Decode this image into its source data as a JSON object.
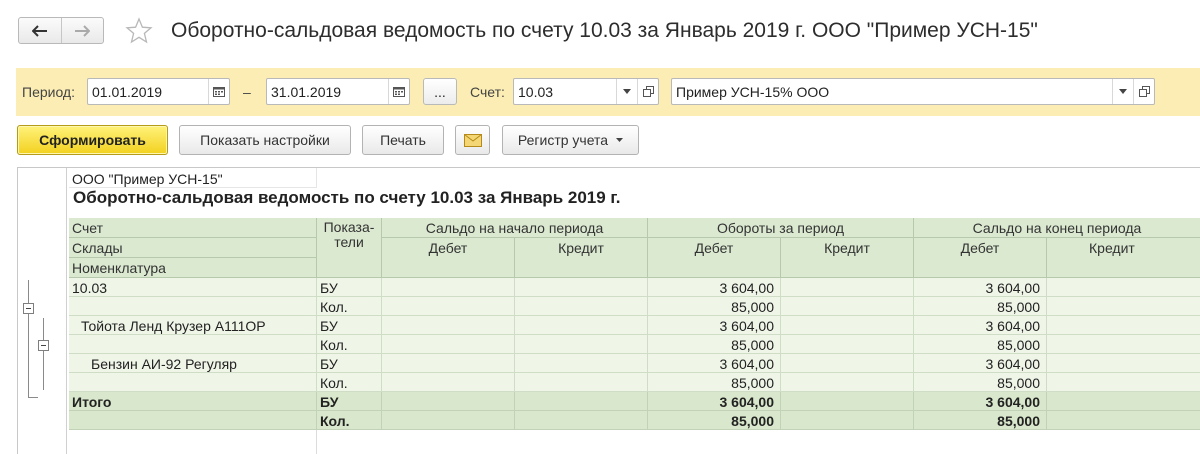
{
  "header": {
    "title": "Оборотно-сальдовая ведомость по счету 10.03 за Январь 2019 г. ООО \"Пример УСН-15\"",
    "back_icon": "arrow-left-icon",
    "forward_icon": "arrow-right-icon",
    "favorite_icon": "star-icon"
  },
  "filters": {
    "period_label": "Период:",
    "date_from": "01.01.2019",
    "dash": "–",
    "date_to": "31.01.2019",
    "more_label": "...",
    "account_label": "Счет:",
    "account_value": "10.03",
    "org_value": "Пример УСН-15% ООО"
  },
  "toolbar": {
    "generate": "Сформировать",
    "show_settings": "Показать настройки",
    "print": "Печать",
    "register": "Регистр учета"
  },
  "report": {
    "org": "ООО \"Пример УСН-15\"",
    "title": "Оборотно-сальдовая ведомость по счету 10.03 за Январь 2019 г.",
    "headers": {
      "account": "Счет",
      "warehouses": "Склады",
      "nomenclature": "Номенклатура",
      "indicators_1": "Показа-",
      "indicators_2": "тели",
      "opening": "Сальдо на начало периода",
      "turnover": "Обороты за период",
      "closing": "Сальдо на конец периода",
      "debit": "Дебет",
      "credit": "Кредит"
    },
    "rows": [
      {
        "name": "10.03",
        "ind": "БУ",
        "turn_debit": "3 604,00",
        "close_debit": "3 604,00"
      },
      {
        "name": "",
        "ind": "Кол.",
        "turn_debit": "85,000",
        "close_debit": "85,000"
      },
      {
        "name": "Тойота Ленд Крузер А111ОР",
        "ind": "БУ",
        "turn_debit": "3 604,00",
        "close_debit": "3 604,00"
      },
      {
        "name": "",
        "ind": "Кол.",
        "turn_debit": "85,000",
        "close_debit": "85,000"
      },
      {
        "name": "Бензин АИ-92 Регуляр",
        "ind": "БУ",
        "turn_debit": "3 604,00",
        "close_debit": "3 604,00"
      },
      {
        "name": "",
        "ind": "Кол.",
        "turn_debit": "85,000",
        "close_debit": "85,000"
      }
    ],
    "total": {
      "name": "Итого",
      "ind1": "БУ",
      "ind2": "Кол.",
      "sum1": "3 604,00",
      "sum2": "85,000",
      "close1": "3 604,00",
      "close2": "85,000"
    }
  },
  "colors": {
    "panel": "#fbedb3",
    "primary_button": "#f2d11f",
    "header_cell": "#dbe9d0",
    "data_cell": "#eff6e8",
    "total_cell": "#d9e8cc"
  }
}
